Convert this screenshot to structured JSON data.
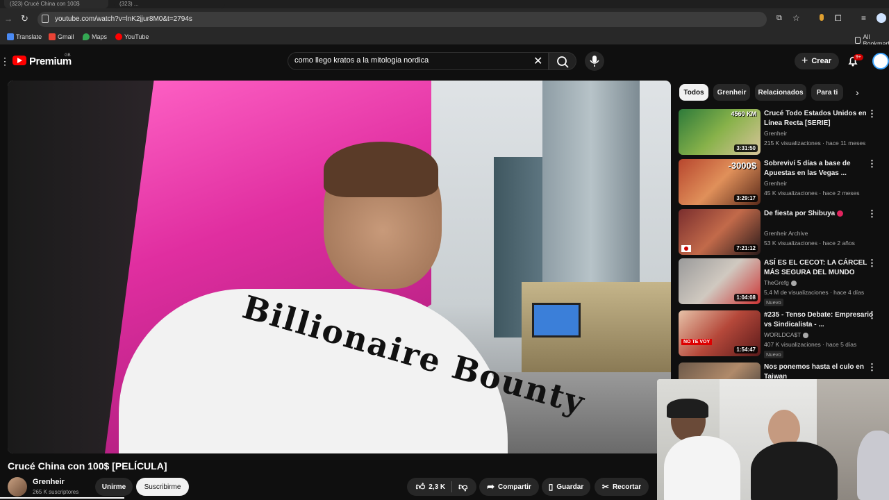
{
  "browser": {
    "url": "youtube.com/watch?v=lnK2jjur8M0&t=2794s",
    "tabs": [
      "(323) Crucé China con 100$",
      "(323) ..."
    ],
    "bookmarks": [
      "Translate",
      "Gmail",
      "Maps",
      "YouTube"
    ],
    "all_bookmarks": "All Bookmarks"
  },
  "header": {
    "logo": "Premium",
    "logo_region": "GB",
    "search_value": "como llego kratos a la mitologia nordica",
    "create_label": "Crear",
    "notifications_badge": "9+"
  },
  "video": {
    "title": "Crucé China con 100$ [PELÍCULA]",
    "shirt_print": "Billionaire Bounty",
    "progress": 0.14
  },
  "channel": {
    "name": "Grenheir",
    "subscribers": "265 K suscriptores",
    "join_label": "Unirme",
    "subscribe_label": "Suscribirme"
  },
  "actions": {
    "likes": "2,3 K",
    "share": "Compartir",
    "save": "Guardar",
    "clip": "Recortar"
  },
  "chips": [
    "Todos",
    "Grenheir",
    "Relacionados",
    "Para ti"
  ],
  "recommendations": [
    {
      "title": "Crucé Todo Estados Unidos en Línea Recta [SERIE]",
      "channel": "Grenheir",
      "meta": "215 K visualizaciones · hace 11 meses",
      "duration": "3:31:50",
      "overlay": "4560 KM",
      "thumb": "#3b6e2f"
    },
    {
      "title": "Sobreviví 5 días a base de Apuestas en las Vegas ...",
      "channel": "Grenheir",
      "meta": "45 K visualizaciones · hace 2 meses",
      "duration": "3:29:17",
      "overlay": "-3000$",
      "thumb": "#9a3f2a"
    },
    {
      "title": "De fiesta por Shibuya",
      "channel": "Grenheir Archive",
      "meta": "53 K visualizaciones · hace 2 años",
      "duration": "7:21:12",
      "overlay": "",
      "thumb": "#7a3a3a"
    },
    {
      "title": "ASÍ ES EL CECOT: LA CÁRCEL MÁS SEGURA DEL MUNDO",
      "channel": "TheGrefg",
      "meta": "5,4 M de visualizaciones · hace 4 días",
      "duration": "1:04:08",
      "badge": "Nuevo",
      "overlay": "",
      "thumb": "#8c8c8c"
    },
    {
      "title": "#235 - Tenso Debate: Empresario vs Sindicalista - ...",
      "channel": "WORLDCA$T",
      "meta": "407 K visualizaciones · hace 5 días",
      "duration": "1:54:47",
      "badge": "Nuevo",
      "overlay": "NO TE VOY",
      "thumb": "#b5483a"
    },
    {
      "title": "Nos ponemos hasta el culo en Taiwan",
      "channel": "",
      "meta": "",
      "duration": "",
      "overlay": "",
      "thumb": "#6d5a4a"
    }
  ],
  "colors": {
    "brand": "#ff0000",
    "background": "#0f0f0f",
    "chip_active": "#f1f1f1"
  }
}
